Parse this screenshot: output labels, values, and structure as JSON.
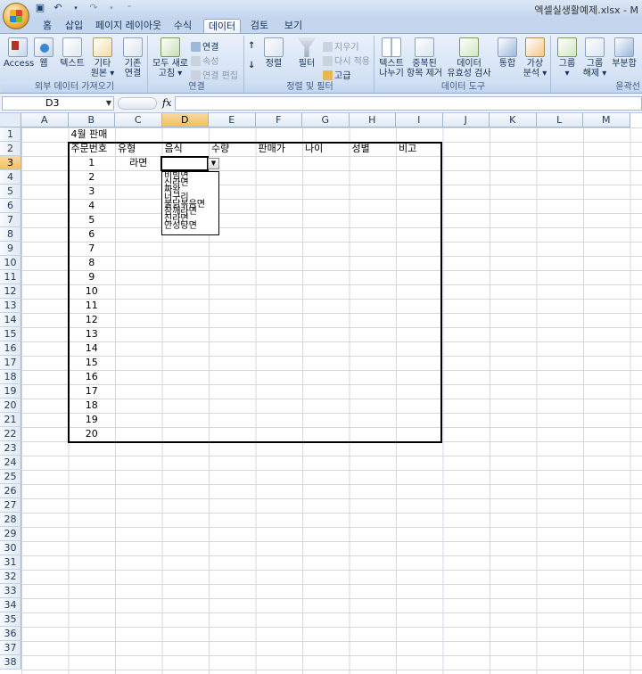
{
  "window": {
    "title": "엑셀실생활예제.xlsx - M"
  },
  "tabs": [
    "홈",
    "삽입",
    "페이지 레이아웃",
    "수식",
    "데이터",
    "검토",
    "보기"
  ],
  "active_tab": "데이터",
  "ribbon": {
    "external": {
      "access": "Access",
      "web": "웹",
      "text": "텍스트",
      "other_1": "기타",
      "other_2": "원본 ▾",
      "existing_1": "기존",
      "existing_2": "연결",
      "label": "외부 데이터 가져오기"
    },
    "connections": {
      "refresh_1": "모두 새로",
      "refresh_2": "고침 ▾",
      "connections": "연결",
      "properties": "속성",
      "edit_links": "연결 편집",
      "label": "연결"
    },
    "sortfilter": {
      "sort": "정렬",
      "filter": "필터",
      "clear": "지우기",
      "reapply": "다시 적용",
      "advanced": "고급",
      "label": "정렬 및 필터"
    },
    "tools": {
      "t2c_1": "텍스트",
      "t2c_2": "나누기",
      "dup_1": "중복된",
      "dup_2": "항목 제거",
      "valid_1": "데이터",
      "valid_2": "유효성 검사 ▾",
      "consolidate": "통합",
      "whatif_1": "가상",
      "whatif_2": "분석 ▾",
      "label": "데이터 도구"
    },
    "outline": {
      "group_1": "그룹",
      "group_2": "▾",
      "ungroup_1": "그룹",
      "ungroup_2": "해제 ▾",
      "subtotal": "부분합",
      "label": "윤곽선"
    }
  },
  "formula_bar": {
    "name_box": "D3",
    "fx": "fx",
    "formula": ""
  },
  "columns": [
    "A",
    "B",
    "C",
    "D",
    "E",
    "F",
    "G",
    "H",
    "I",
    "J",
    "K",
    "L",
    "M"
  ],
  "selected_column": "D",
  "selected_row": "3",
  "rows": [
    "1",
    "2",
    "3",
    "4",
    "5",
    "6",
    "7",
    "8",
    "9",
    "10",
    "11",
    "12",
    "13",
    "14",
    "15",
    "16",
    "17",
    "18",
    "19",
    "20",
    "21",
    "22",
    "23",
    "24",
    "25",
    "26",
    "27",
    "28",
    "29",
    "30",
    "31",
    "32",
    "33",
    "34",
    "35",
    "36",
    "37",
    "38"
  ],
  "sheet": {
    "title": "4월 판매",
    "headers": [
      "주문번호",
      "유형",
      "음식",
      "수량",
      "판매가",
      "나이",
      "성별",
      "비고"
    ],
    "order_numbers": [
      "1",
      "2",
      "3",
      "4",
      "5",
      "6",
      "7",
      "8",
      "9",
      "10",
      "11",
      "12",
      "13",
      "14",
      "15",
      "16",
      "17",
      "18",
      "19",
      "20"
    ],
    "first_type": "라면"
  },
  "dropdown": {
    "items": [
      "비빔면",
      "신라면",
      "짜왕",
      "너구리",
      "불닭볶음면",
      "참깨라면",
      "진라면",
      "안성탕면"
    ]
  }
}
